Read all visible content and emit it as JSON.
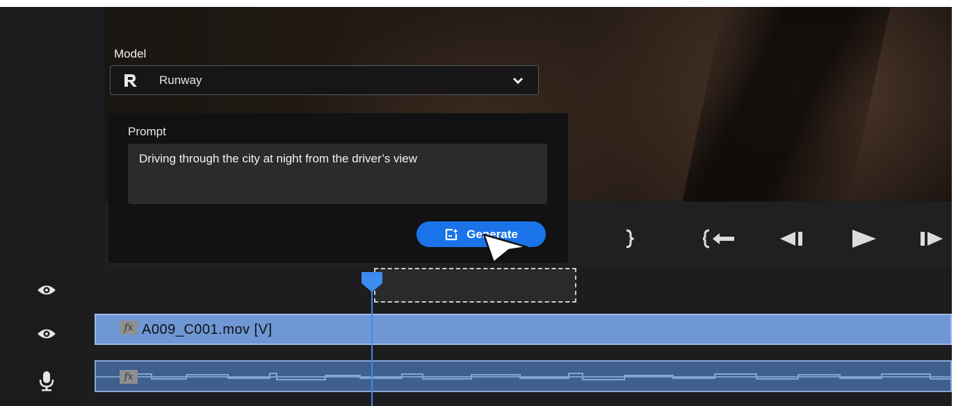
{
  "model": {
    "label": "Model",
    "selected": "Runway",
    "icon": "runway-logo-icon"
  },
  "prompt": {
    "label": "Prompt",
    "value": "Driving through the city at night from the driver’s view"
  },
  "generate": {
    "label": "Generate",
    "icon": "generate-sparkle-icon",
    "color": "#1a73e8"
  },
  "transport": {
    "icons": [
      "mark-out-icon",
      "go-to-in-icon",
      "step-back-icon",
      "play-icon",
      "step-forward-icon"
    ]
  },
  "timeline": {
    "tracks": [
      {
        "type": "placeholder",
        "icon": "eye-icon"
      },
      {
        "type": "video",
        "icon": "eye-icon",
        "clip_name": "A009_C001.mov [V]",
        "badge": "fx"
      },
      {
        "type": "audio",
        "icon": "microphone-icon",
        "badge": "fx"
      }
    ],
    "colors": {
      "video_clip": "#6e97d4",
      "audio_clip": "#3f5f8e",
      "playhead": "#3b8bf0"
    }
  }
}
